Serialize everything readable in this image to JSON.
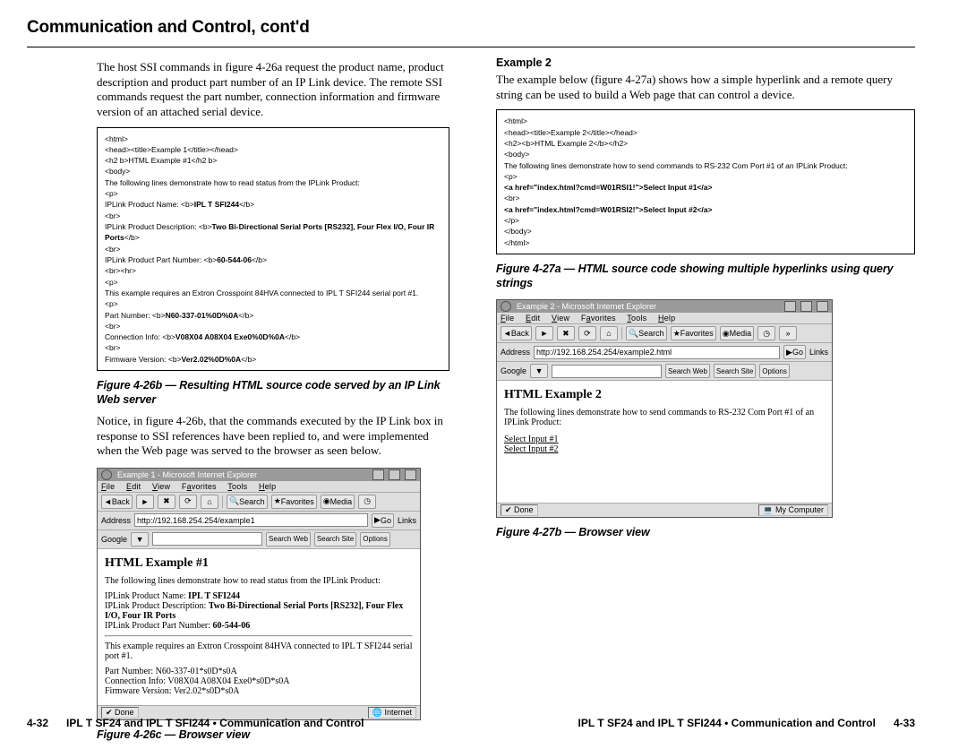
{
  "header": "Communication and Control, cont'd",
  "left": {
    "p1": "The host SSI commands in figure 4-26a request the product name, product description and product part number of an IP Link device. The remote SSI commands request the part number, connection information and firmware version of an attached serial device.",
    "code": {
      "l1": "<html>",
      "l2": "<head><title>Example 1</title></head>",
      "l3": "<h2 b>HTML Example #1</h2 b>",
      "l4": "<body>",
      "l5": "The following lines demonstrate how to read status from the IPLink Product:",
      "l6": "<p>",
      "l7a": "IPLink Product Name: <b>",
      "l7b": "IPL T SFI244",
      "l7c": "</b>",
      "l8": "<br>",
      "l9a": "IPLink Product Description: <b>",
      "l9b": "Two Bi-Directional Serial Ports [RS232], Four Flex I/O, Four IR Ports",
      "l9c": "</b>",
      "l10": "<br>",
      "l11a": "IPLink Product Part Number: <b>",
      "l11b": "60-544-06",
      "l11c": "</b>",
      "l12": "<br><hr>",
      "l13": "<p>",
      "l14": "This example requires an Extron Crosspoint 84HVA connected to IPL T SFI244 serial port #1.",
      "l15": "<p>",
      "l16a": "Part Number: <b>",
      "l16b": "N60-337-01%0D%0A",
      "l16c": "</b>",
      "l17": "<br>",
      "l18a": "Connection Info: <b>",
      "l18b": "V08X04 A08X04 Exe0%0D%0A",
      "l18c": "</b>",
      "l19": "<br>",
      "l20a": "Firmware Version: <b>",
      "l20b": "Ver2.02%0D%0A",
      "l20c": "</b>"
    },
    "fig26b": "Figure 4-26b — Resulting HTML source code served by an IP Link Web server",
    "p2": "Notice, in figure 4-26b, that the commands executed by the IP Link box in response to SSI references have been replied to, and were implemented when the Web page was served to the browser as seen below.",
    "browser": {
      "title": "Example 1 - Microsoft Internet Explorer",
      "menu": {
        "file": "File",
        "edit": "Edit",
        "view": "View",
        "fav": "Favorites",
        "tools": "Tools",
        "help": "Help"
      },
      "back": "Back",
      "search": "Search",
      "favorites": "Favorites",
      "media": "Media",
      "addr_label": "Address",
      "url": "http://192.168.254.254/example1",
      "go": "Go",
      "links": "Links",
      "google": "Google",
      "searchweb": "Search Web",
      "searchsite": "Search Site",
      "options": "Options",
      "h": "HTML Example #1",
      "line1": "The following lines demonstrate how to read status from the IPLink Product:",
      "pn_l": "IPLink Product Name: ",
      "pn_b": "IPL T SFI244",
      "pd_l": "IPLink Product Description: ",
      "pd_b": "Two Bi-Directional Serial Ports [RS232], Four Flex I/O, Four IR Ports",
      "pp_l": "IPLink Product Part Number: ",
      "pp_b": "60-544-06",
      "mid": "This example requires an Extron Crosspoint 84HVA connected to IPL T SFI244 serial port #1.",
      "a1": "Part Number: N60-337-01*s0D*s0A",
      "a2": "Connection Info: V08X04 A08X04 Exe0*s0D*s0A",
      "a3": "Firmware Version: Ver2.02*s0D*s0A",
      "done": "Done",
      "internet": "Internet"
    },
    "fig26c": "Figure 4-26c — Browser view"
  },
  "right": {
    "ex2": "Example 2",
    "p1": "The example below (figure 4-27a) shows how a simple hyperlink and a remote query string can be used to build a Web page that can control a device.",
    "code": {
      "l1": "<html>",
      "l2": "<head><title>Example 2</title></head>",
      "l3": "<h2><b>HTML Example 2</b></h2>",
      "l4": "<body>",
      "l5": "The following lines demonstrate how to send commands to RS-232 Com Port #1 of an IPLink Product:",
      "l6": "<p>",
      "l7": "<a href=\"index.html?cmd=W01RSI1!\">Select Input #1</a>",
      "l8": "<br>",
      "l9": "<a href=\"index.html?cmd=W01RSI2!\">Select Input #2</a>",
      "l10": "</p>",
      "l11": "</body>",
      "l12": "</html>"
    },
    "fig27a": "Figure 4-27a — HTML source code showing multiple hyperlinks using query strings",
    "browser": {
      "title": "Example 2 - Microsoft Internet Explorer",
      "menu": {
        "file": "File",
        "edit": "Edit",
        "view": "View",
        "fav": "Favorites",
        "tools": "Tools",
        "help": "Help"
      },
      "back": "Back",
      "search": "Search",
      "favorites": "Favorites",
      "media": "Media",
      "addr_label": "Address",
      "url": "http://192.168.254.254/example2.html",
      "go": "Go",
      "links": "Links",
      "google": "Google",
      "searchweb": "Search Web",
      "searchsite": "Search Site",
      "options": "Options",
      "h": "HTML Example 2",
      "line1": "The following lines demonstrate how to send commands to RS-232 Com Port #1 of an IPLink Product:",
      "link1": "Select Input #1",
      "link2": "Select Input #2",
      "done": "Done",
      "mycomp": "My Computer"
    },
    "fig27b": "Figure 4-27b — Browser view"
  },
  "footer": {
    "pn_left": "4-32",
    "text": "IPL T SF24 and IPL T SFI244 • Communication and Control",
    "pn_right": "4-33"
  }
}
